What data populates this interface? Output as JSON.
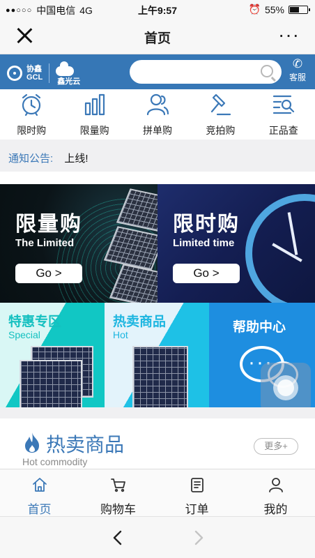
{
  "status_bar": {
    "carrier": "中国电信",
    "network": "4G",
    "time": "上午9:57",
    "battery": "55%",
    "battery_level": 0.55
  },
  "title_bar": {
    "title": "首页"
  },
  "header": {
    "logo_cn": "协鑫",
    "logo_en": "GCL",
    "cloud_name": "鑫光云",
    "search_placeholder": "",
    "service_label": "客服"
  },
  "categories": [
    {
      "label": "限时购",
      "icon": "alarm-clock-icon"
    },
    {
      "label": "限量购",
      "icon": "bar-chart-icon"
    },
    {
      "label": "拼单购",
      "icon": "group-users-icon"
    },
    {
      "label": "竞拍购",
      "icon": "gavel-icon"
    },
    {
      "label": "正品查",
      "icon": "search-list-icon"
    }
  ],
  "notice": {
    "label": "通知公告:",
    "text": "上线!"
  },
  "banners": [
    {
      "title": "限量购",
      "subtitle": "The Limited",
      "button": "Go >"
    },
    {
      "title": "限时购",
      "subtitle": "Limited time",
      "button": "Go >"
    }
  ],
  "cards": [
    {
      "title": "特惠专区",
      "subtitle": "Special"
    },
    {
      "title": "热卖商品",
      "subtitle": "Hot"
    },
    {
      "title": "帮助中心",
      "subtitle": ""
    }
  ],
  "hot_section": {
    "title": "热卖商品",
    "subtitle": "Hot commodity",
    "more": "更多+"
  },
  "tabs": [
    {
      "label": "首页",
      "icon": "home-icon",
      "active": true
    },
    {
      "label": "购物车",
      "icon": "cart-icon",
      "active": false
    },
    {
      "label": "订单",
      "icon": "order-icon",
      "active": false
    },
    {
      "label": "我的",
      "icon": "user-icon",
      "active": false
    }
  ],
  "colors": {
    "brand_blue": "#3677b6",
    "accent_blue": "#3b78b7",
    "teal": "#11c7c4",
    "help_blue": "#1e8ee0"
  }
}
